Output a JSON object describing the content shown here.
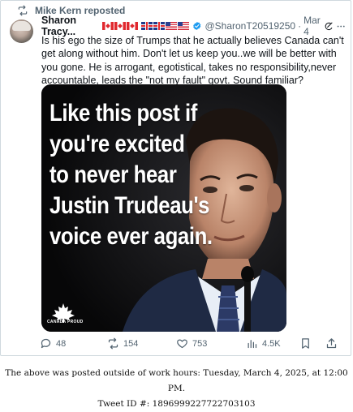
{
  "repost": {
    "label": "Mike Kern reposted"
  },
  "author": {
    "name": "Sharon Tracy...",
    "flags": [
      "ca",
      "ca",
      "ca",
      "uk",
      "uk",
      "us",
      "us"
    ],
    "handle": "@SharonT20519250",
    "separator": "·",
    "date": "Mar 4"
  },
  "tweet": {
    "text": "Is his ego the size of Trumps that he actually believes Canada can't get along without him. Don't let us keep you..we will be better with you gone. He is arrogant, egotistical, takes no responsibility,never accountable, leads the \"not my fault\" govt. Sound familiar?"
  },
  "media": {
    "overlay_text": "Like this post if\nyou're excited\nto never hear\nJustin Trudeau's\nvoice ever again.",
    "logo_label": "CANADA PROUD"
  },
  "actions": {
    "replies": "48",
    "reposts": "154",
    "likes": "753",
    "views": "4.5K"
  },
  "footer": {
    "line1": "The above was posted outside of work hours: Tuesday, March 4, 2025, at 12:00 PM.",
    "line2": "Tweet ID #: 1896999227722703103"
  },
  "colors": {
    "verified": "#1d9bf0",
    "muted": "#536471",
    "border": "#cfd9de"
  }
}
